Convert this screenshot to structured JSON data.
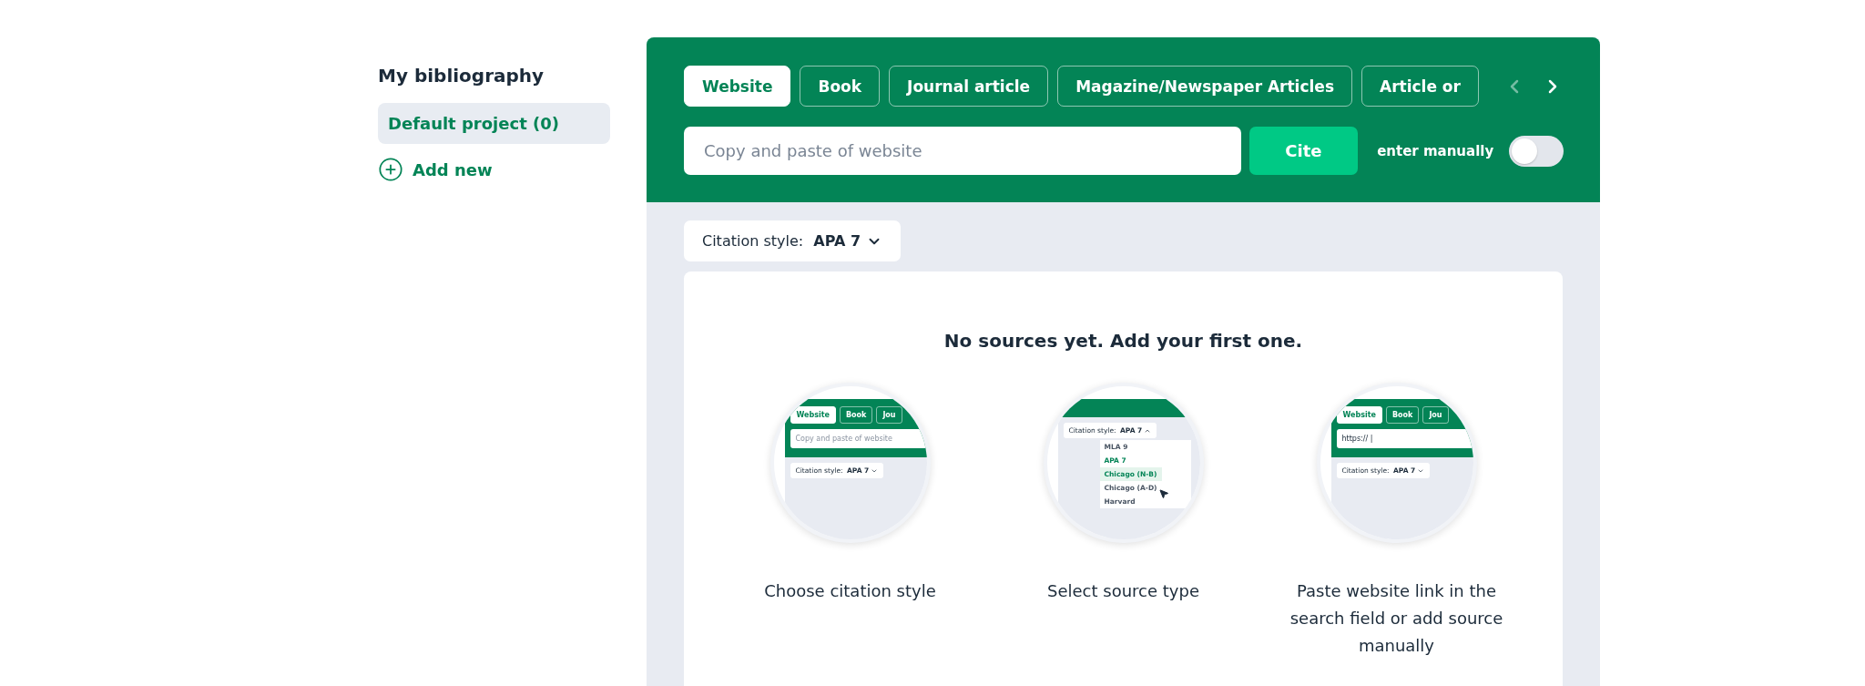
{
  "sidebar": {
    "title": "My bibliography",
    "projects": [
      {
        "label": "Default project (0)",
        "selected": true
      }
    ],
    "add_new": "Add new"
  },
  "header": {
    "tabs": [
      {
        "label": "Website",
        "selected": true
      },
      {
        "label": "Book",
        "selected": false
      },
      {
        "label": "Journal article",
        "selected": false
      },
      {
        "label": "Magazine/Newspaper Articles",
        "selected": false
      },
      {
        "label": "Article or",
        "selected": false
      }
    ],
    "prev_disabled": true,
    "next_disabled": false,
    "search": {
      "placeholder": "Copy and paste of website"
    },
    "cite_button": "Cite",
    "manual_label": "enter manually",
    "manual_on": false
  },
  "citation_style": {
    "label": "Citation style:",
    "value": "APA 7"
  },
  "empty_state": {
    "heading": "No sources yet. Add your first one.",
    "steps": [
      {
        "caption": "Choose citation style",
        "illustration": {
          "kind": "form",
          "tabs": [
            {
              "label": "Website",
              "selected": true
            },
            {
              "label": "Book",
              "selected": false
            },
            {
              "label": "Jou",
              "selected": false
            }
          ],
          "field": {
            "placeholder": "Copy and paste of website"
          },
          "style_label": "Citation style:",
          "style_value": "APA 7"
        }
      },
      {
        "caption": "Select source type",
        "illustration": {
          "kind": "dropdown",
          "style_label": "Citation style:",
          "style_value": "APA 7",
          "expanded": true,
          "options": [
            {
              "label": "MLA 9",
              "selected": false,
              "highlighted": false
            },
            {
              "label": "APA 7",
              "selected": true,
              "highlighted": false
            },
            {
              "label": "Chicago (N-B)",
              "selected": false,
              "highlighted": true
            },
            {
              "label": "Chicago (A-D)",
              "selected": false,
              "highlighted": false
            },
            {
              "label": "Harvard",
              "selected": false,
              "highlighted": false
            }
          ]
        }
      },
      {
        "caption": "Paste website link in the search field or add source manually",
        "illustration": {
          "kind": "form",
          "tabs": [
            {
              "label": "Website",
              "selected": true
            },
            {
              "label": "Book",
              "selected": false
            },
            {
              "label": "Jou",
              "selected": false
            }
          ],
          "field": {
            "value": "https:// |"
          },
          "style_label": "Citation style:",
          "style_value": "APA 7"
        }
      }
    ]
  }
}
